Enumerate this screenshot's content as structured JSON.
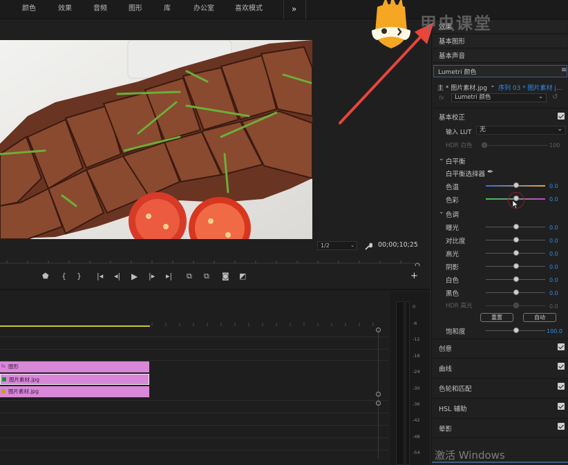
{
  "top_tabs": [
    "颜色",
    "效果",
    "音频",
    "图形",
    "库",
    "办公室",
    "喜欢模式"
  ],
  "top_more": "»",
  "watermark": "甲虫课堂",
  "windows_watermark": "激活 Windows",
  "right_panel": {
    "section_rows": [
      "效果",
      "基本图形",
      "基本声音"
    ],
    "lumetri_title": "Lumetri 颜色",
    "menu_icon": "≡",
    "master_clip": "主 * 图片素材.jpg",
    "sequence_clip": "序列 03 * 图片素材 j...",
    "fx_label": "fx",
    "effect_select": "Lumetri 颜色",
    "basic_correction": "基本校正",
    "input_lut_label": "输入 LUT",
    "input_lut_value": "无",
    "hdr_white_label": "HDR 白色",
    "hdr_white_value": "100",
    "white_balance": "白平衡",
    "wb_selector": "白平衡选择器",
    "temp_label": "色温",
    "temp_value": "0.0",
    "tint_label": "色彩",
    "tint_value": "0.0",
    "tone": "色调",
    "tone_rows": [
      {
        "label": "曝光",
        "value": "0.0"
      },
      {
        "label": "对比度",
        "value": "0.0"
      },
      {
        "label": "高光",
        "value": "0.0"
      },
      {
        "label": "阴影",
        "value": "0.0"
      },
      {
        "label": "白色",
        "value": "0.0"
      },
      {
        "label": "黑色",
        "value": "0.0"
      },
      {
        "label": "HDR 高光",
        "value": "0.0"
      }
    ],
    "reset_button": "重置",
    "auto_button": "自动",
    "saturation_label": "饱和度",
    "saturation_value": "100.0",
    "collapsed_sections": [
      "创意",
      "曲线",
      "色轮和匹配",
      "HSL 辅助",
      "晕影"
    ]
  },
  "monitor": {
    "zoom_select": "1/2",
    "timecode": "00;00;10;25",
    "add_button": "+"
  },
  "timeline": {
    "clips": [
      "图形",
      "图片素材.jpg",
      "图片素材.jpg"
    ],
    "meter_labels": [
      "0",
      "-6",
      "-12",
      "-18",
      "-24",
      "-30",
      "-36",
      "-42",
      "-48",
      "-54"
    ]
  },
  "colors": {
    "accent_blue": "#2d8ceb",
    "clip_pink": "#d987d9",
    "playhead_yellow": "#c8c832",
    "arrow_red": "#e8453c",
    "logo_orange": "#f5a623"
  }
}
